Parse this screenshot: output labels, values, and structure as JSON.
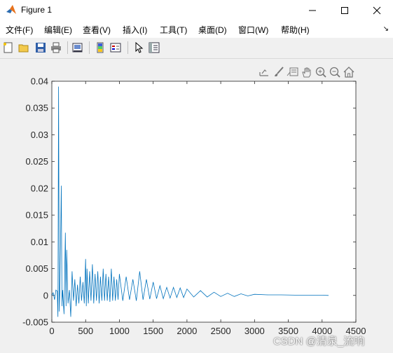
{
  "window": {
    "title": "Figure 1",
    "controls": [
      "minimize",
      "maximize",
      "close"
    ]
  },
  "menubar": {
    "items": [
      {
        "label": "文件(F)"
      },
      {
        "label": "编辑(E)"
      },
      {
        "label": "查看(V)"
      },
      {
        "label": "插入(I)"
      },
      {
        "label": "工具(T)"
      },
      {
        "label": "桌面(D)"
      },
      {
        "label": "窗口(W)"
      },
      {
        "label": "帮助(H)"
      }
    ],
    "overflow_arrow": "↘"
  },
  "toolbar": {
    "icons": [
      "new-figure-icon",
      "open-file-icon",
      "save-icon",
      "print-icon",
      "link-plot-icon",
      "insert-colorbar-icon",
      "insert-legend-icon",
      "edit-plot-icon",
      "property-inspector-icon"
    ]
  },
  "axes_toolbar": {
    "icons": [
      "export-icon",
      "brush-icon",
      "data-tips-icon",
      "pan-icon",
      "zoom-in-icon",
      "zoom-out-icon",
      "restore-view-icon"
    ]
  },
  "chart_data": {
    "type": "line",
    "title": "",
    "xlabel": "",
    "ylabel": "",
    "xlim": [
      0,
      4500
    ],
    "ylim": [
      -0.005,
      0.04
    ],
    "xticks": [
      0,
      500,
      1000,
      1500,
      2000,
      2500,
      3000,
      3500,
      4000,
      4500
    ],
    "yticks": [
      -0.005,
      0,
      0.005,
      0.01,
      0.015,
      0.02,
      0.025,
      0.03,
      0.035,
      0.04
    ],
    "xtick_labels": [
      "0",
      "500",
      "1000",
      "1500",
      "2000",
      "2500",
      "3000",
      "3500",
      "4000",
      "4500"
    ],
    "ytick_labels": [
      "-0.005",
      "0",
      "0.005",
      "0.01",
      "0.015",
      "0.02",
      "0.025",
      "0.03",
      "0.035",
      "0.04"
    ],
    "grid": false,
    "line_color": "#0072bd",
    "series": [
      {
        "x": [
          0,
          20,
          40,
          60,
          80,
          90,
          100,
          110,
          120,
          140,
          150,
          160,
          180,
          200,
          210,
          220,
          240,
          260,
          280,
          300,
          320,
          340,
          360,
          380,
          400,
          420,
          440,
          460,
          480,
          500,
          510,
          520,
          540,
          560,
          580,
          600,
          620,
          640,
          660,
          680,
          700,
          720,
          740,
          760,
          780,
          800,
          820,
          840,
          860,
          880,
          900,
          920,
          940,
          960,
          980,
          1000,
          1050,
          1100,
          1150,
          1200,
          1250,
          1300,
          1350,
          1400,
          1450,
          1500,
          1550,
          1600,
          1650,
          1700,
          1750,
          1800,
          1850,
          1900,
          1950,
          2000,
          2100,
          2200,
          2300,
          2400,
          2500,
          2600,
          2700,
          2800,
          2900,
          3000,
          3200,
          3400,
          3600,
          3800,
          4000,
          4096
        ],
        "y": [
          0,
          0.0005,
          -0.0008,
          0.001,
          0.0008,
          -0.004,
          0.039,
          -0.003,
          0.0015,
          0.0205,
          -0.002,
          0.001,
          -0.0035,
          0.0117,
          -0.002,
          0.0085,
          -0.0015,
          0.001,
          -0.004,
          0.0045,
          -0.001,
          0.003,
          -0.002,
          0.002,
          -0.0015,
          0.0035,
          -0.001,
          0.0025,
          -0.0015,
          0.0068,
          -0.002,
          0.005,
          -0.0015,
          0.0045,
          -0.001,
          0.0058,
          -0.0015,
          0.004,
          -0.001,
          0.0045,
          -0.0015,
          0.0035,
          -0.001,
          0.005,
          -0.001,
          0.004,
          -0.001,
          0.0035,
          -0.0012,
          0.005,
          -0.001,
          0.0035,
          -0.001,
          0.003,
          -0.0008,
          0.004,
          -0.001,
          0.0035,
          -0.0008,
          0.003,
          -0.001,
          0.0045,
          -0.0008,
          0.003,
          -0.0007,
          0.0025,
          -0.0006,
          0.0018,
          -0.0006,
          0.0015,
          -0.0005,
          0.0015,
          -0.0004,
          0.0014,
          -0.0004,
          0.0012,
          -0.0003,
          0.0009,
          -0.0003,
          0.0006,
          -0.0002,
          0.0004,
          -0.0002,
          0.0003,
          -0.0001,
          0.0002,
          0.0001,
          0.0001,
          5e-05,
          5e-05,
          3e-05,
          0
        ]
      }
    ]
  },
  "watermark": "CSDN @清泉_流响"
}
